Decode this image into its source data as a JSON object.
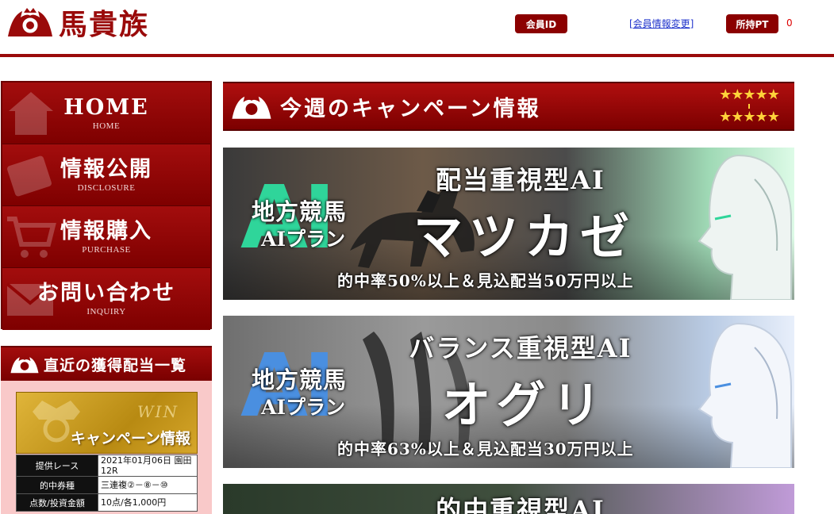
{
  "header": {
    "logo_text": "馬貴族",
    "member_id_label": "会員ID",
    "member_info_link": "[会員情報変更]",
    "points_label": "所持PT",
    "points_value": "0"
  },
  "nav": {
    "items": [
      {
        "label": "HOME",
        "sub": "HOME",
        "icon": "house-icon"
      },
      {
        "label": "情報公開",
        "sub": "DISCLOSURE",
        "icon": "document-icon"
      },
      {
        "label": "情報購入",
        "sub": "PURCHASE",
        "icon": "cart-icon"
      },
      {
        "label": "お問い合わせ",
        "sub": "INQUIRY",
        "icon": "envelope-icon"
      }
    ]
  },
  "sidebar": {
    "heading": "直近の獲得配当一覧",
    "banner_word": "WIN",
    "banner_title": "キャンペーン情報",
    "rows": [
      {
        "key": "提供レース",
        "value": "2021年01月06日 園田12R"
      },
      {
        "key": "的中券種",
        "value": "三連複②－⑧－⑩"
      },
      {
        "key": "点数/投資金額",
        "value": "10点/各1,000円"
      }
    ]
  },
  "main": {
    "section_title": "今週のキャンペーン情報",
    "stars_top": "★★★★★",
    "stars_bottom": "★★★★★",
    "banners": [
      {
        "ai_letters": "AI",
        "plan_line1": "地方競馬",
        "plan_line2": "AIプラン",
        "subtitle": "配当重視型AI",
        "name": "マツカゼ",
        "condition": "的中率50%以上＆見込配当50万円以上",
        "accent": "#2fd59a"
      },
      {
        "ai_letters": "AI",
        "plan_line1": "地方競馬",
        "plan_line2": "AIプラン",
        "subtitle": "バランス重視型AI",
        "name": "オグリ",
        "condition": "的中率63%以上＆見込配当30万円以上",
        "accent": "#4a8fe0"
      },
      {
        "subtitle": "的中重視型AI"
      }
    ]
  },
  "colors": {
    "brand_red": "#9a0a0a",
    "link_blue": "#1f33cc",
    "star_gold": "#ffd23a"
  }
}
